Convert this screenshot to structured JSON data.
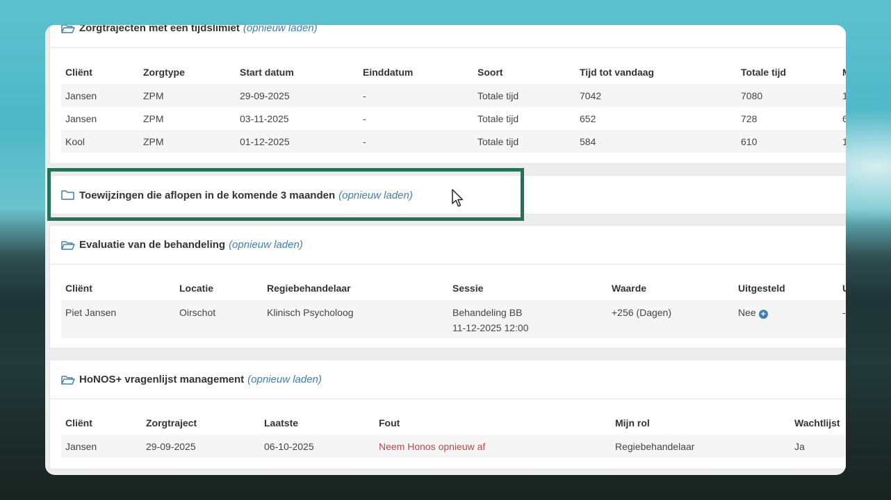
{
  "panels": {
    "trajecten": {
      "title": "Zorgtrajecten met een tijdslimiet",
      "reload": "(opnieuw laden)",
      "columns": [
        "Cliënt",
        "Zorgtype",
        "Start datum",
        "Einddatum",
        "Soort",
        "Tijd tot vandaag",
        "Totale tijd",
        "M"
      ],
      "rows": [
        [
          "Jansen",
          "ZPM",
          "29-09-2025",
          "-",
          "Totale tijd",
          "7042",
          "7080",
          "1"
        ],
        [
          "Jansen",
          "ZPM",
          "03-11-2025",
          "-",
          "Totale tijd",
          "652",
          "728",
          "6"
        ],
        [
          "Kool",
          "ZPM",
          "01-12-2025",
          "-",
          "Totale tijd",
          "584",
          "610",
          "1"
        ]
      ]
    },
    "toewijzingen": {
      "title": "Toewijzingen die aflopen in de komende 3 maanden",
      "reload": "(opnieuw laden)"
    },
    "evaluatie": {
      "title": "Evaluatie van de behandeling",
      "reload": "(opnieuw laden)",
      "columns": [
        "Cliënt",
        "Locatie",
        "Regiebehandelaar",
        "Sessie",
        "Waarde",
        "Uitgesteld",
        "U"
      ],
      "row": {
        "client": "Piet Jansen",
        "locatie": "Oirschot",
        "regie": "Klinisch Psycholoog",
        "sessie_name": "Behandeling BB",
        "sessie_date": "11-12-2025 12:00",
        "waarde": "+256 (Dagen)",
        "uitgesteld": "Nee",
        "extra": "-"
      }
    },
    "honos": {
      "title": "HoNOS+ vragenlijst management",
      "reload": "(opnieuw laden)",
      "columns": [
        "Cliënt",
        "Zorgtraject",
        "Laatste",
        "Fout",
        "Mijn rol",
        "Wachtlijst"
      ],
      "row": {
        "client": "Jansen",
        "zorgtraject": "29-09-2025",
        "laatste": "06-10-2025",
        "fout": "Neem Honos opnieuw af",
        "rol": "Regiebehandelaar",
        "wachtlijst": "Ja"
      }
    }
  },
  "colors": {
    "accent": "#3d7fb3",
    "highlight": "#22735a",
    "error": "#b94a48"
  }
}
